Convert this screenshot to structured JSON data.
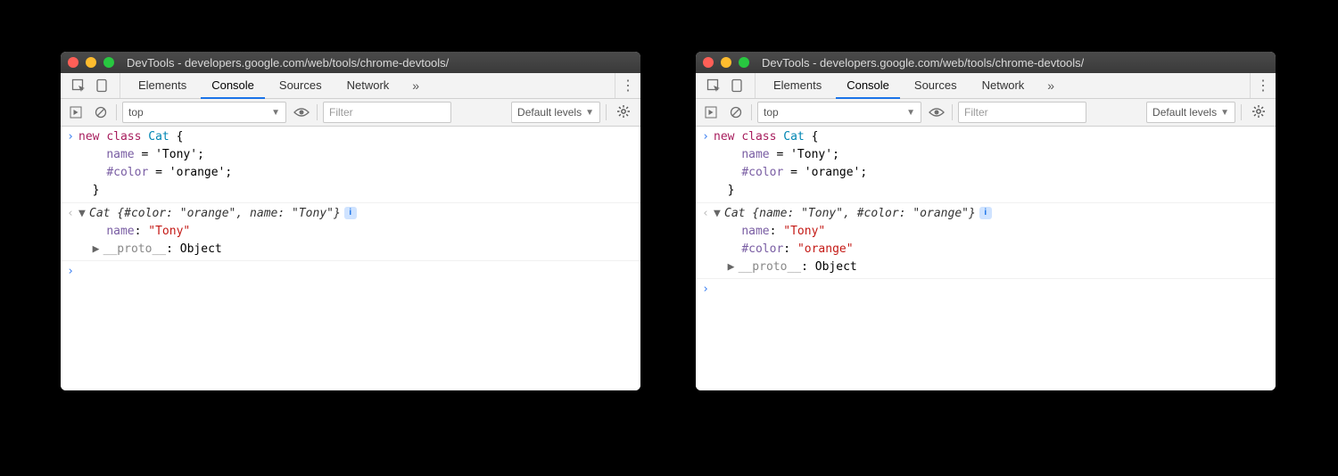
{
  "title": "DevTools - developers.google.com/web/tools/chrome-devtools/",
  "tabs": {
    "elements": "Elements",
    "console": "Console",
    "sources": "Sources",
    "network": "Network",
    "more": "»",
    "menu": "⋮"
  },
  "console_toolbar": {
    "context": "top",
    "filter_placeholder": "Filter",
    "levels": "Default levels"
  },
  "code_input": {
    "line1_kw": "new",
    "line1_cls": "class",
    "line1_name": "Cat",
    "line1_brace": " {",
    "line2_prop": "name",
    "line2_rest": " = 'Tony';",
    "line3_prop": "#color",
    "line3_rest": " = 'orange';",
    "line4": "}"
  },
  "output_left": {
    "summary_pre": "Cat {",
    "s_k1": "#color",
    "s_sep1": ": ",
    "s_v1": "\"orange\"",
    "s_comma": ", ",
    "s_k2": "name",
    "s_sep2": ": ",
    "s_v2": "\"Tony\"",
    "summary_post": "}",
    "info": "i",
    "p1_k": "name",
    "p1_s": ": ",
    "p1_v": "\"Tony\"",
    "proto_k": "__proto__",
    "proto_s": ": Object"
  },
  "output_right": {
    "summary_pre": "Cat {",
    "s_k1": "name",
    "s_sep1": ": ",
    "s_v1": "\"Tony\"",
    "s_comma": ", ",
    "s_k2": "#color",
    "s_sep2": ": ",
    "s_v2": "\"orange\"",
    "summary_post": "}",
    "info": "i",
    "p1_k": "name",
    "p1_s": ": ",
    "p1_v": "\"Tony\"",
    "p2_k": "#color",
    "p2_s": ": ",
    "p2_v": "\"orange\"",
    "proto_k": "__proto__",
    "proto_s": ": Object"
  }
}
